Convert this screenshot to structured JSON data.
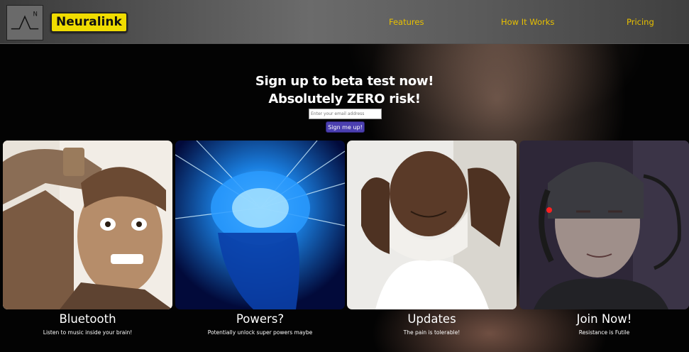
{
  "nav": {
    "brand": "Neuralink",
    "logo_letter": "N",
    "links": [
      "Features",
      "How It Works",
      "Pricing"
    ]
  },
  "signup": {
    "headline_1": "Sign up to beta test now!",
    "headline_2": "Absolutely ZERO risk!",
    "email_placeholder": "Enter your email address",
    "button_label": "Sign me up!"
  },
  "cards": [
    {
      "title": "Bluetooth",
      "description": "Listen to music inside your brain!"
    },
    {
      "title": "Powers?",
      "description": "Potentially unlock super powers maybe"
    },
    {
      "title": "Updates",
      "description": "The pain is tolerable!"
    },
    {
      "title": "Join Now!",
      "description": "Resistance is Futile"
    }
  ],
  "colors": {
    "brand_bg": "#f0dc00",
    "nav_link": "#e8c000",
    "button_bg": "#4b3fb0"
  }
}
